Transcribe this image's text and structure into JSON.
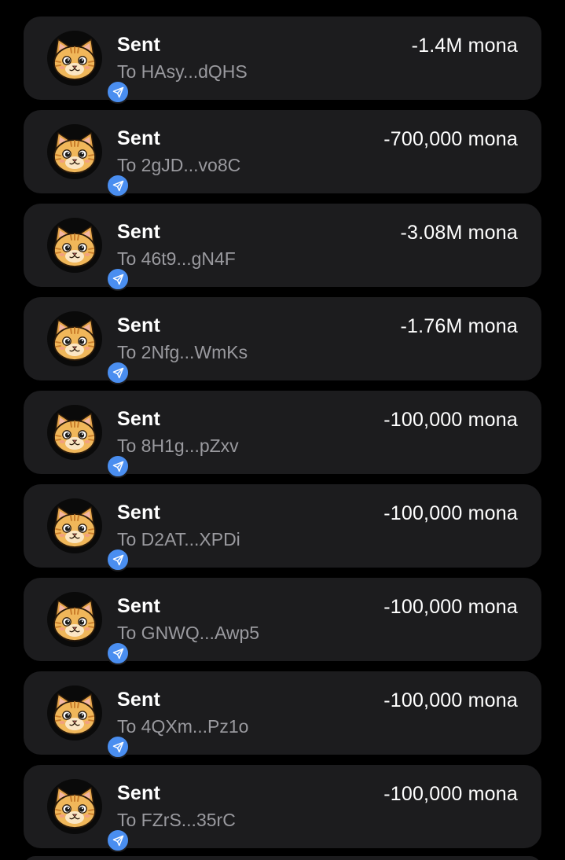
{
  "colors": {
    "background": "#000000",
    "card": "#1c1c1e",
    "badge": "#4a8ef0",
    "title": "#ffffff",
    "subtitle": "#9a9a9f"
  },
  "transactions": [
    {
      "title": "Sent",
      "to": "To HAsy...dQHS",
      "amount": "-1.4M mona",
      "avatar_icon": "cat-token-icon",
      "badge_icon": "send-arrow-icon"
    },
    {
      "title": "Sent",
      "to": "To 2gJD...vo8C",
      "amount": "-700,000 mona",
      "avatar_icon": "cat-token-icon",
      "badge_icon": "send-arrow-icon"
    },
    {
      "title": "Sent",
      "to": "To 46t9...gN4F",
      "amount": "-3.08M mona",
      "avatar_icon": "cat-token-icon",
      "badge_icon": "send-arrow-icon"
    },
    {
      "title": "Sent",
      "to": "To 2Nfg...WmKs",
      "amount": "-1.76M mona",
      "avatar_icon": "cat-token-icon",
      "badge_icon": "send-arrow-icon"
    },
    {
      "title": "Sent",
      "to": "To 8H1g...pZxv",
      "amount": "-100,000 mona",
      "avatar_icon": "cat-token-icon",
      "badge_icon": "send-arrow-icon"
    },
    {
      "title": "Sent",
      "to": "To D2AT...XPDi",
      "amount": "-100,000 mona",
      "avatar_icon": "cat-token-icon",
      "badge_icon": "send-arrow-icon"
    },
    {
      "title": "Sent",
      "to": "To GNWQ...Awp5",
      "amount": "-100,000 mona",
      "avatar_icon": "cat-token-icon",
      "badge_icon": "send-arrow-icon"
    },
    {
      "title": "Sent",
      "to": "To 4QXm...Pz1o",
      "amount": "-100,000 mona",
      "avatar_icon": "cat-token-icon",
      "badge_icon": "send-arrow-icon"
    },
    {
      "title": "Sent",
      "to": "To FZrS...35rC",
      "amount": "-100,000 mona",
      "avatar_icon": "cat-token-icon",
      "badge_icon": "send-arrow-icon"
    }
  ]
}
